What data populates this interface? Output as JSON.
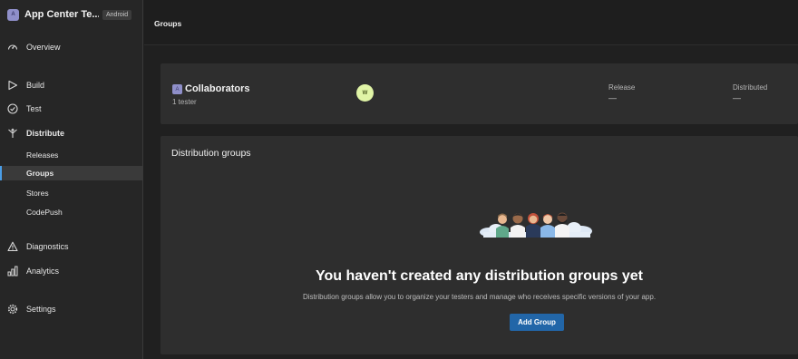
{
  "app": {
    "avatar_letter": "A",
    "name": "App Center Te...",
    "platform": "Android"
  },
  "sidebar": {
    "items": [
      {
        "label": "Overview",
        "icon": "dashboard-icon"
      },
      {
        "label": "Build",
        "icon": "play-icon"
      },
      {
        "label": "Test",
        "icon": "check-circle-icon"
      },
      {
        "label": "Distribute",
        "icon": "distribute-icon"
      },
      {
        "label": "Diagnostics",
        "icon": "warning-icon"
      },
      {
        "label": "Analytics",
        "icon": "bar-chart-icon"
      },
      {
        "label": "Settings",
        "icon": "gear-icon"
      }
    ],
    "distribute_sub": [
      {
        "label": "Releases"
      },
      {
        "label": "Groups",
        "active": true
      },
      {
        "label": "Stores"
      },
      {
        "label": "CodePush"
      }
    ]
  },
  "header": {
    "title": "Groups"
  },
  "collaborators": {
    "icon_letter": "A",
    "name": "Collaborators",
    "count": "1 tester",
    "member_initial": "W",
    "release_label": "Release",
    "release_value": "—",
    "distributed_label": "Distributed",
    "distributed_value": "—"
  },
  "distribution_groups": {
    "title": "Distribution groups",
    "empty_heading": "You haven't created any distribution groups yet",
    "empty_description": "Distribution groups allow you to organize your testers and manage who receives specific versions of your app.",
    "add_button": "Add Group"
  },
  "colors": {
    "accent": "#2266a8",
    "active_indicator": "#4a9ee8",
    "avatar_bg": "#e0f4a6"
  }
}
